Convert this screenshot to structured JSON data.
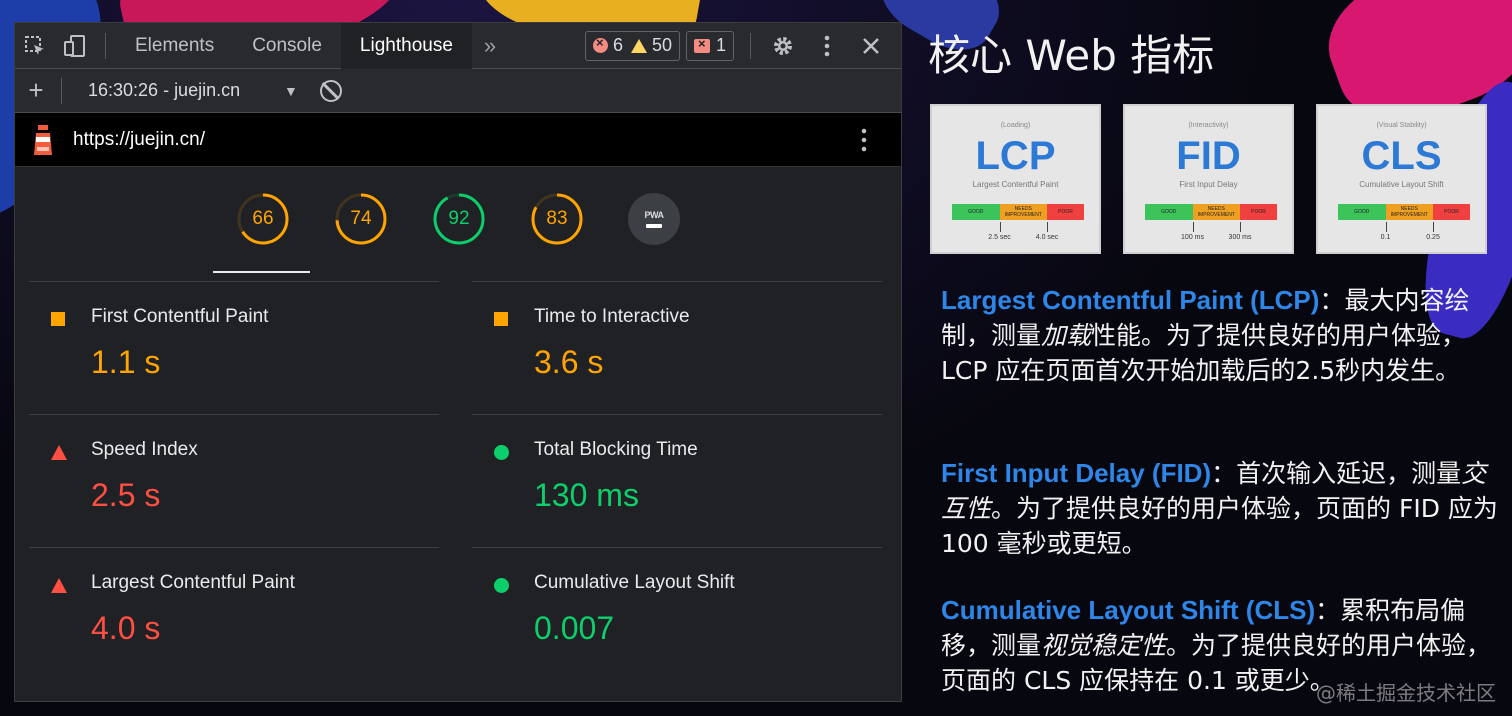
{
  "devtools": {
    "tabs": [
      "Elements",
      "Console",
      "Lighthouse"
    ],
    "active_tab": "Lighthouse",
    "more_tabs": "»",
    "error_count": "6",
    "warning_count": "50",
    "issue_count": "1",
    "session_label": "16:30:26 - juejin.cn",
    "url": "https://juejin.cn/"
  },
  "gauges": [
    {
      "score": "66",
      "level": 0.66,
      "color": "#ffa400"
    },
    {
      "score": "74",
      "level": 0.74,
      "color": "#ffa400"
    },
    {
      "score": "92",
      "level": 0.92,
      "color": "#0cce6b"
    },
    {
      "score": "83",
      "level": 0.83,
      "color": "#ffa400"
    }
  ],
  "pwa_label": "PWA",
  "metrics": [
    {
      "label": "First Contentful Paint",
      "value": "1.1 s",
      "status": "average"
    },
    {
      "label": "Time to Interactive",
      "value": "3.6 s",
      "status": "average"
    },
    {
      "label": "Speed Index",
      "value": "2.5 s",
      "status": "fail"
    },
    {
      "label": "Total Blocking Time",
      "value": "130 ms",
      "status": "pass"
    },
    {
      "label": "Largest Contentful Paint",
      "value": "4.0 s",
      "status": "fail"
    },
    {
      "label": "Cumulative Layout Shift",
      "value": "0.007",
      "status": "pass"
    }
  ],
  "slide": {
    "title": "核心 Web 指标",
    "cards": [
      {
        "sub": "(Loading)",
        "abbr": "LCP",
        "name": "Largest Contentful Paint",
        "good": "GOOD",
        "ni": "NEEDS IMPROVEMENT",
        "poor": "POOR",
        "t1": "2.5 sec",
        "t2": "4.0 sec"
      },
      {
        "sub": "(Interactivity)",
        "abbr": "FID",
        "name": "First Input Delay",
        "good": "GOOD",
        "ni": "NEEDS IMPROVEMENT",
        "poor": "POOR",
        "t1": "100 ms",
        "t2": "300 ms"
      },
      {
        "sub": "(Visual Stability)",
        "abbr": "CLS",
        "name": "Cumulative Layout Shift",
        "good": "GOOD",
        "ni": "NEEDS IMPROVEMENT",
        "poor": "POOR",
        "t1": "0.1",
        "t2": "0.25"
      }
    ],
    "paragraphs": [
      {
        "hl": "Largest Contentful Paint (LCP)",
        "pre": "：最大内容绘制，测量",
        "em": "加载",
        "post": "性能。为了提供良好的用户体验，LCP 应在页面首次开始加载后的2.5秒内发生。"
      },
      {
        "hl": "First Input Delay (FID)",
        "pre": "：首次输入延迟，测量",
        "em": "交互性",
        "post": "。为了提供良好的用户体验，页面的 FID 应为100 毫秒或更短。"
      },
      {
        "hl": "Cumulative Layout Shift (CLS)",
        "pre": "：累积布局偏移，测量",
        "em": "视觉稳定性",
        "post": "。为了提供良好的用户体验，页面的 CLS 应保持在 0.1 或更少。"
      }
    ],
    "watermark": "@稀土掘金技术社区"
  },
  "colors": {
    "orange": "#ffa400",
    "red": "#ff4e42",
    "green": "#0cce6b",
    "link_blue": "#2d86e8"
  }
}
